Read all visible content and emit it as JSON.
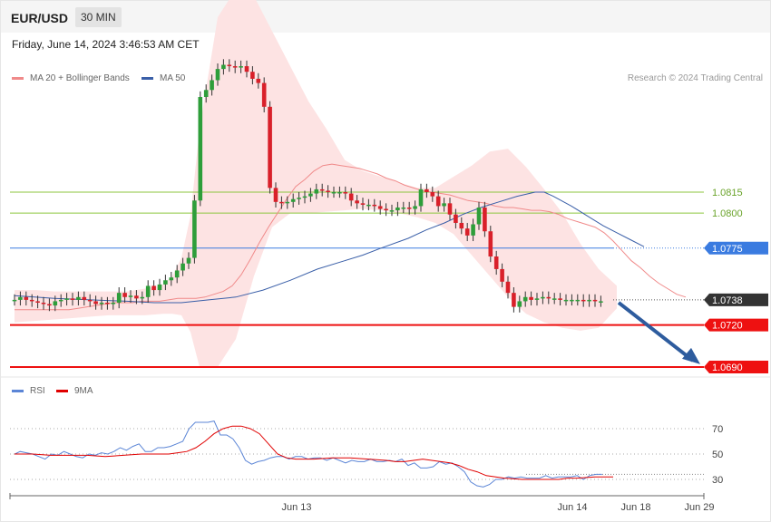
{
  "header": {
    "symbol": "EUR/USD",
    "timeframe": "30 MIN",
    "datetime": "Friday, June 14, 2024 3:46:53 AM CET",
    "credit": "Research © 2024 Trading Central"
  },
  "legend": {
    "ma20": {
      "label": "MA 20 + Bollinger Bands",
      "color": "#f08a8a"
    },
    "ma50": {
      "label": "MA 50",
      "color": "#3a5fa8"
    },
    "rsi": {
      "label": "RSI",
      "color": "#5b85d6"
    },
    "ma9": {
      "label": "9MA",
      "color": "#e00000"
    }
  },
  "chart_data": [
    {
      "type": "line",
      "panel": "price",
      "ylim": [
        1.0675,
        1.0905
      ],
      "x_ticks": [
        "Jun 13",
        "Jun 14",
        "Jun 18",
        "Jun 29"
      ],
      "levels": [
        {
          "value": 1.0815,
          "label": "1.0815",
          "style": "resistance",
          "color": "#8cc63f"
        },
        {
          "value": 1.08,
          "label": "1.0800",
          "style": "resistance",
          "color": "#8cc63f"
        },
        {
          "value": 1.0775,
          "label": "1.0775",
          "style": "pivot",
          "color": "#3a7be0"
        },
        {
          "value": 1.0738,
          "label": "1.0738",
          "style": "last",
          "color": "#333333"
        },
        {
          "value": 1.072,
          "label": "1.0720",
          "style": "support",
          "color": "#ee1111"
        },
        {
          "value": 1.069,
          "label": "1.0690",
          "style": "support",
          "color": "#ee1111"
        }
      ],
      "close": [
        1.0738,
        1.074,
        1.0738,
        1.0737,
        1.0736,
        1.0735,
        1.0734,
        1.0737,
        1.0738,
        1.0739,
        1.0738,
        1.074,
        1.0738,
        1.0737,
        1.0735,
        1.0736,
        1.0735,
        1.0736,
        1.0743,
        1.074,
        1.0741,
        1.0739,
        1.074,
        1.0748,
        1.0745,
        1.0749,
        1.0752,
        1.0754,
        1.0759,
        1.0764,
        1.0768,
        1.0809,
        1.0883,
        1.0888,
        1.0895,
        1.0903,
        1.0906,
        1.0905,
        1.0904,
        1.0905,
        1.0901,
        1.0896,
        1.0893,
        1.0876,
        1.0818,
        1.0808,
        1.0807,
        1.0808,
        1.081,
        1.0811,
        1.0812,
        1.0814,
        1.0817,
        1.0816,
        1.0815,
        1.0815,
        1.0815,
        1.0814,
        1.0809,
        1.0807,
        1.0806,
        1.0806,
        1.0805,
        1.0803,
        1.0802,
        1.0802,
        1.0804,
        1.0804,
        1.0803,
        1.0805,
        1.0817,
        1.0815,
        1.0812,
        1.0805,
        1.0807,
        1.0799,
        1.0793,
        1.0789,
        1.0784,
        1.0792,
        1.0804,
        1.0787,
        1.0769,
        1.076,
        1.0751,
        1.0743,
        1.0733,
        1.0737,
        1.074,
        1.0738,
        1.0739,
        1.074,
        1.0739,
        1.0739,
        1.0738,
        1.0738,
        1.0738,
        1.0738,
        1.0737,
        1.0738,
        1.0737,
        1.0737
      ],
      "ma20": [
        1.0731,
        1.0731,
        1.0731,
        1.0731,
        1.0731,
        1.0731,
        1.0731,
        1.0732,
        1.0733,
        1.0734,
        1.0735,
        1.0736,
        1.0736,
        1.0736,
        1.0737,
        1.0737,
        1.0737,
        1.0738,
        1.0739,
        1.0739,
        1.0739,
        1.074,
        1.0742,
        1.0744,
        1.0748,
        1.0756,
        1.0767,
        1.0779,
        1.079,
        1.08,
        1.081,
        1.0819,
        1.0824,
        1.083,
        1.0834,
        1.0835,
        1.0834,
        1.0833,
        1.0832,
        1.083,
        1.0828,
        1.0825,
        1.0823,
        1.082,
        1.0818,
        1.0816,
        1.0815,
        1.0814,
        1.0813,
        1.0811,
        1.0809,
        1.0808,
        1.0807,
        1.0805,
        1.0804,
        1.0804,
        1.0803,
        1.0802,
        1.0802,
        1.0801,
        1.0799,
        1.0796,
        1.0794,
        1.0792,
        1.079,
        1.0786,
        1.078,
        1.0773,
        1.0766,
        1.0761,
        1.0755,
        1.075,
        1.0746,
        1.0742,
        1.074
      ],
      "ma20_x": [
        16,
        26,
        36,
        46,
        56,
        66,
        76,
        86,
        96,
        106,
        116,
        126,
        136,
        146,
        156,
        166,
        176,
        186,
        196,
        206,
        216,
        226,
        236,
        246,
        256,
        266,
        276,
        286,
        296,
        306,
        316,
        326,
        336,
        346,
        356,
        366,
        376,
        386,
        396,
        406,
        416,
        426,
        436,
        446,
        456,
        466,
        476,
        486,
        496,
        506,
        516,
        526,
        536,
        546,
        556,
        566,
        576,
        586,
        596,
        606,
        616,
        626,
        636,
        646,
        656,
        666,
        676,
        686,
        696,
        706,
        716,
        726,
        736,
        746,
        756
      ],
      "ma50": [
        1.0741,
        1.0739,
        1.0738,
        1.0737,
        1.0736,
        1.0736,
        1.0738,
        1.074,
        1.0745,
        1.0752,
        1.076,
        1.0766,
        1.077,
        1.0775,
        1.0782,
        1.0788,
        1.0793,
        1.0799,
        1.0804,
        1.0808,
        1.0812,
        1.0815,
        1.0815,
        1.0812,
        1.0805,
        1.0797,
        1.0791,
        1.0786,
        1.0781,
        1.0776
      ],
      "ma50_x": [
        16,
        60,
        100,
        140,
        170,
        200,
        230,
        260,
        290,
        320,
        350,
        380,
        400,
        420,
        450,
        470,
        490,
        510,
        530,
        550,
        570,
        590,
        600,
        610,
        630,
        650,
        665,
        680,
        695,
        710
      ],
      "bb_upper": [
        1.0745,
        1.0745,
        1.0744,
        1.0744,
        1.0744,
        1.0744,
        1.0744,
        1.0746,
        1.0749,
        1.0755,
        1.0768,
        1.0798,
        1.086,
        1.094,
        1.096,
        1.0955,
        1.093,
        1.0905,
        1.088,
        1.086,
        1.0838,
        1.083,
        1.0826,
        1.0822,
        1.0818,
        1.0818,
        1.0826,
        1.0834,
        1.0844,
        1.0846,
        1.0833,
        1.0817,
        1.08,
        1.0778,
        1.076,
        1.0748
      ],
      "bb_lower": [
        1.0722,
        1.0723,
        1.0724,
        1.0725,
        1.0726,
        1.0727,
        1.0727,
        1.0727,
        1.0728,
        1.0728,
        1.0727,
        1.0715,
        1.069,
        1.069,
        1.071,
        1.0755,
        1.079,
        1.08,
        1.08,
        1.0801,
        1.0802,
        1.0803,
        1.0802,
        1.08,
        1.0797,
        1.0793,
        1.0785,
        1.077,
        1.0755,
        1.074,
        1.0728,
        1.0722,
        1.0718,
        1.0716,
        1.0718,
        1.0732
      ],
      "bb_x": [
        16,
        40,
        60,
        80,
        100,
        120,
        140,
        160,
        180,
        190,
        200,
        210,
        220,
        240,
        260,
        280,
        300,
        320,
        340,
        360,
        380,
        400,
        420,
        440,
        460,
        480,
        500,
        520,
        540,
        560,
        580,
        600,
        620,
        640,
        660,
        680
      ],
      "forecast": {
        "from": 1.0736,
        "to": 1.0692
      }
    },
    {
      "type": "line",
      "panel": "rsi",
      "ylim": [
        20,
        80
      ],
      "y_ticks": [
        70,
        50,
        30
      ],
      "rsi": [
        50,
        52,
        51,
        50,
        48,
        46,
        50,
        49,
        52,
        50,
        48,
        47,
        50,
        49,
        51,
        50,
        52,
        55,
        53,
        56,
        58,
        52,
        52,
        55,
        55,
        56,
        58,
        60,
        70,
        75,
        75,
        75,
        76,
        65,
        65,
        62,
        55,
        45,
        42,
        44,
        45,
        47,
        48,
        48,
        46,
        48,
        48,
        46,
        47,
        47,
        45,
        47,
        45,
        43,
        45,
        44,
        44,
        46,
        44,
        44,
        45,
        44,
        46,
        41,
        43,
        39,
        39,
        40,
        44,
        42,
        43,
        40,
        36,
        28,
        25,
        24,
        26,
        30,
        30,
        32,
        31,
        32,
        31,
        31,
        31,
        33,
        31,
        32,
        32,
        32,
        33,
        30,
        33,
        34,
        34
      ],
      "rsi_x": [
        16,
        21,
        27,
        33,
        39,
        45,
        51,
        57,
        63,
        69,
        75,
        81,
        87,
        93,
        99,
        105,
        111,
        117,
        123,
        129,
        135,
        141,
        147,
        153,
        159,
        165,
        171,
        177,
        183,
        189,
        195,
        201,
        207,
        213,
        219,
        225,
        231,
        237,
        243,
        249,
        255,
        261,
        267,
        273,
        279,
        285,
        291,
        297,
        303,
        309,
        315,
        321,
        327,
        333,
        339,
        345,
        351,
        357,
        363,
        369,
        375,
        381,
        387,
        393,
        399,
        405,
        411,
        417,
        423,
        429,
        435,
        441,
        447,
        453,
        459,
        465,
        471,
        477,
        483,
        489,
        495,
        501,
        507,
        513,
        519,
        525,
        531,
        537,
        543,
        549,
        555,
        561,
        567,
        573,
        579
      ],
      "ma9": [
        50,
        50,
        49,
        49,
        49,
        48,
        49,
        50,
        50,
        50,
        51,
        52,
        55,
        60,
        66,
        70,
        72,
        72,
        70,
        66,
        58,
        50,
        47,
        46,
        46,
        47,
        47,
        46,
        45,
        44,
        44,
        45,
        46,
        45,
        44,
        43,
        41,
        38,
        36,
        33,
        31,
        30,
        30,
        30,
        31,
        31,
        32,
        32
      ],
      "ma9_x": [
        16,
        36,
        56,
        76,
        96,
        116,
        136,
        156,
        176,
        186,
        196,
        206,
        216,
        226,
        236,
        246,
        256,
        266,
        276,
        286,
        296,
        306,
        316,
        326,
        346,
        366,
        386,
        406,
        426,
        436,
        446,
        456,
        466,
        476,
        486,
        496,
        506,
        516,
        526,
        536,
        556,
        576,
        596,
        616,
        626,
        636,
        656,
        676
      ]
    }
  ]
}
